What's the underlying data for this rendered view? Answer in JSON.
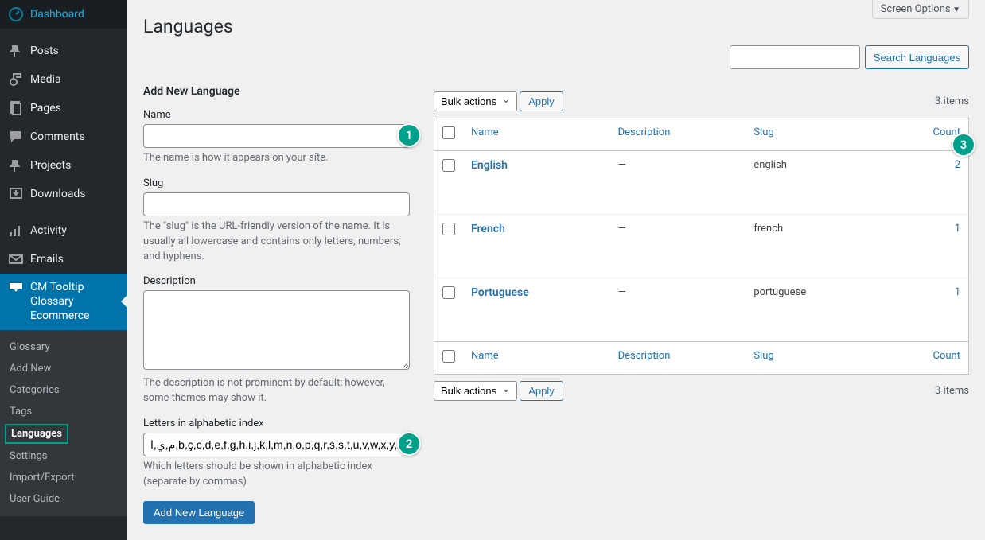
{
  "screen_options_label": "Screen Options",
  "page_title": "Languages",
  "sidebar": {
    "items": [
      {
        "label": "Dashboard",
        "icon": "dashboard"
      },
      {
        "label": "Posts",
        "icon": "pin"
      },
      {
        "label": "Media",
        "icon": "media"
      },
      {
        "label": "Pages",
        "icon": "page"
      },
      {
        "label": "Comments",
        "icon": "comment"
      },
      {
        "label": "Projects",
        "icon": "pin"
      },
      {
        "label": "Downloads",
        "icon": "download"
      },
      {
        "label": "Activity",
        "icon": "activity"
      },
      {
        "label": "Emails",
        "icon": "mail"
      },
      {
        "label": "CM Tooltip Glossary Ecommerce",
        "icon": "tooltip",
        "active": true
      }
    ],
    "submenu": [
      {
        "label": "Glossary"
      },
      {
        "label": "Add New"
      },
      {
        "label": "Categories"
      },
      {
        "label": "Tags"
      },
      {
        "label": "Languages",
        "current": true
      },
      {
        "label": "Settings"
      },
      {
        "label": "Import/Export"
      },
      {
        "label": "User Guide"
      }
    ]
  },
  "form": {
    "heading": "Add New Language",
    "name_label": "Name",
    "name_help": "The name is how it appears on your site.",
    "slug_label": "Slug",
    "slug_help": "The \"slug\" is the URL-friendly version of the name. It is usually all lowercase and contains only letters, numbers, and hyphens.",
    "desc_label": "Description",
    "desc_help": "The description is not prominent by default; however, some themes may show it.",
    "letters_label": "Letters in alphabetic index",
    "letters_value": "م,ي,ا,b,ç,c,d,e,f,g,h,i,j,k,l,m,n,o,p,q,r,ś,s,t,u,v,w,x,y,z",
    "letters_help": "Which letters should be shown in alphabetic index (separate by commas)",
    "submit_label": "Add New Language"
  },
  "search": {
    "button_label": "Search Languages"
  },
  "table": {
    "bulk_label": "Bulk actions",
    "apply_label": "Apply",
    "items_text": "3 items",
    "cols": {
      "name": "Name",
      "description": "Description",
      "slug": "Slug",
      "count": "Count"
    },
    "rows": [
      {
        "name": "English",
        "description": "—",
        "slug": "english",
        "count": "2"
      },
      {
        "name": "French",
        "description": "—",
        "slug": "french",
        "count": "1"
      },
      {
        "name": "Portuguese",
        "description": "—",
        "slug": "portuguese",
        "count": "1"
      }
    ]
  },
  "badges": {
    "b1": "1",
    "b2": "2",
    "b3": "3"
  }
}
